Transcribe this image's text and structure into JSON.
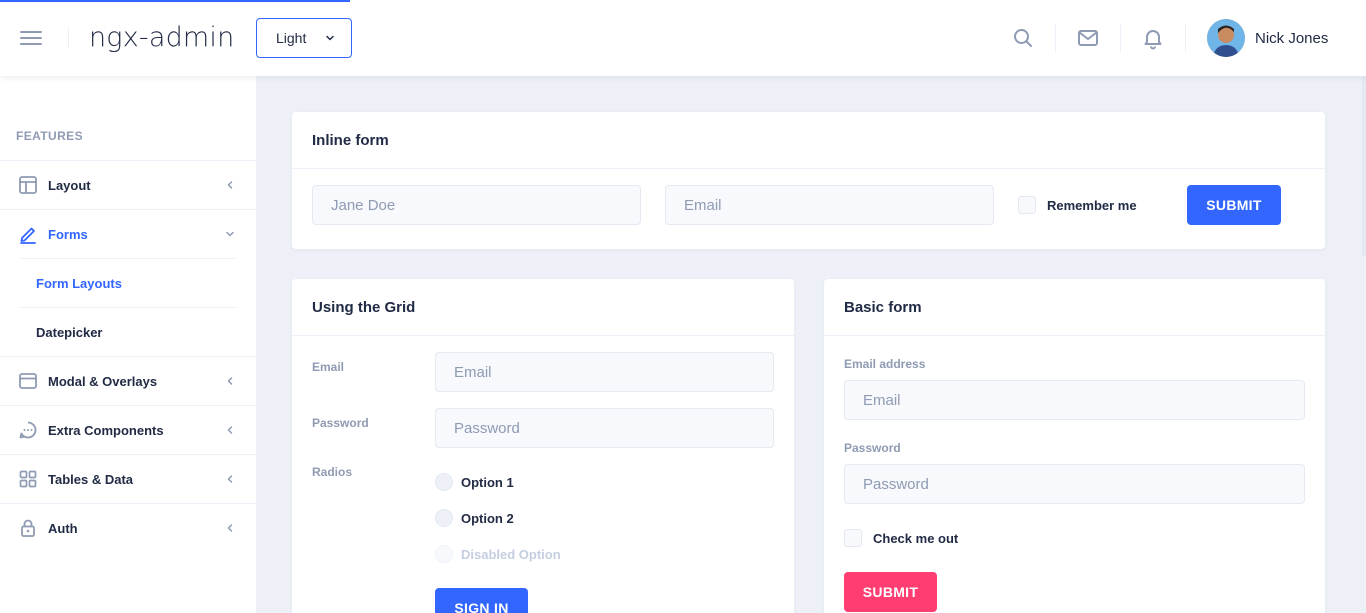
{
  "header": {
    "logo": "ngx-admin",
    "theme_selected": "Light",
    "user_name": "Nick Jones"
  },
  "sidebar": {
    "section_title": "FEATURES",
    "items": [
      {
        "label": "Layout",
        "icon": "layout-icon"
      },
      {
        "label": "Forms",
        "icon": "edit-icon"
      },
      {
        "label": "Modal & Overlays",
        "icon": "browser-icon"
      },
      {
        "label": "Extra Components",
        "icon": "message-circle-icon"
      },
      {
        "label": "Tables & Data",
        "icon": "grid-icon"
      },
      {
        "label": "Auth",
        "icon": "lock-icon"
      }
    ],
    "sub_items": [
      {
        "label": "Form Layouts"
      },
      {
        "label": "Datepicker"
      }
    ]
  },
  "inline_form": {
    "title": "Inline form",
    "name_placeholder": "Jane Doe",
    "email_placeholder": "Email",
    "remember_label": "Remember me",
    "submit_label": "SUBMIT"
  },
  "grid_form": {
    "title": "Using the Grid",
    "email_label": "Email",
    "email_placeholder": "Email",
    "password_label": "Password",
    "password_placeholder": "Password",
    "radios_label": "Radios",
    "options": [
      "Option 1",
      "Option 2",
      "Disabled Option"
    ],
    "signin_label": "SIGN IN"
  },
  "basic_form": {
    "title": "Basic form",
    "email_label": "Email address",
    "email_placeholder": "Email",
    "password_label": "Password",
    "password_placeholder": "Password",
    "check_label": "Check me out",
    "submit_label": "SUBMIT"
  },
  "colors": {
    "primary": "#3366ff",
    "danger": "#ff3d71",
    "text": "#222b45",
    "hint": "#8f9bb3",
    "background": "#edf1f7"
  }
}
